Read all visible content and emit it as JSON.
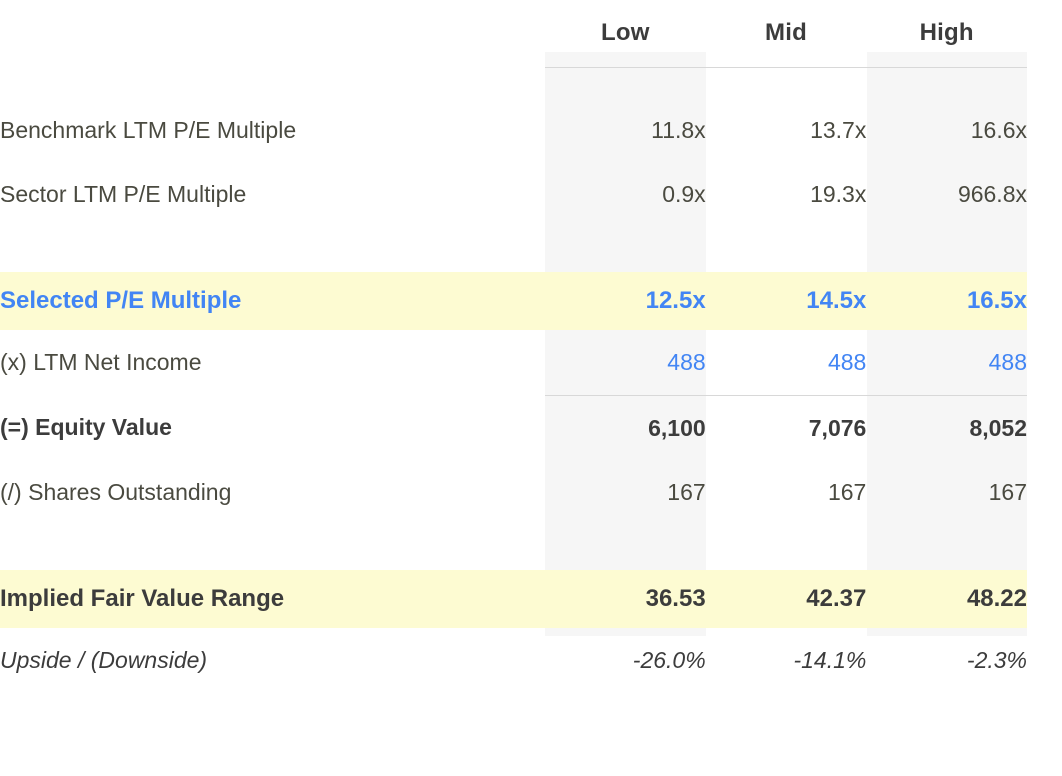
{
  "table": {
    "columns": [
      "",
      "Low",
      "Mid",
      "High"
    ],
    "rows": [
      {
        "label": "Benchmark LTM P/E Multiple",
        "values": [
          "11.8x",
          "13.7x",
          "16.6x"
        ],
        "style": "plain"
      },
      {
        "label": "Sector LTM P/E Multiple",
        "values": [
          "0.9x",
          "19.3x",
          "966.8x"
        ],
        "style": "plain"
      },
      {
        "label": "Selected P/E Multiple",
        "values": [
          "12.5x",
          "14.5x",
          "16.5x"
        ],
        "style": "selected-highlight"
      },
      {
        "label": "(x) LTM Net Income",
        "values": [
          "488",
          "488",
          "488"
        ],
        "style": "blue-values"
      },
      {
        "label": "(=) Equity Value",
        "values": [
          "6,100",
          "7,076",
          "8,052"
        ],
        "style": "bold"
      },
      {
        "label": "(/) Shares Outstanding",
        "values": [
          "167",
          "167",
          "167"
        ],
        "style": "plain"
      },
      {
        "label": "Implied Fair Value Range",
        "values": [
          "36.53",
          "42.37",
          "48.22"
        ],
        "style": "summary-highlight"
      },
      {
        "label": "Upside / (Downside)",
        "values": [
          "-26.0%",
          "-14.1%",
          "-2.3%"
        ],
        "style": "italic"
      }
    ]
  },
  "colors": {
    "highlight_yellow": "#fdfbd2",
    "accent_blue": "#4285f4",
    "column_shade": "#f6f6f6",
    "text_dark": "#3c3c3c",
    "text_body": "#4a4a40"
  }
}
